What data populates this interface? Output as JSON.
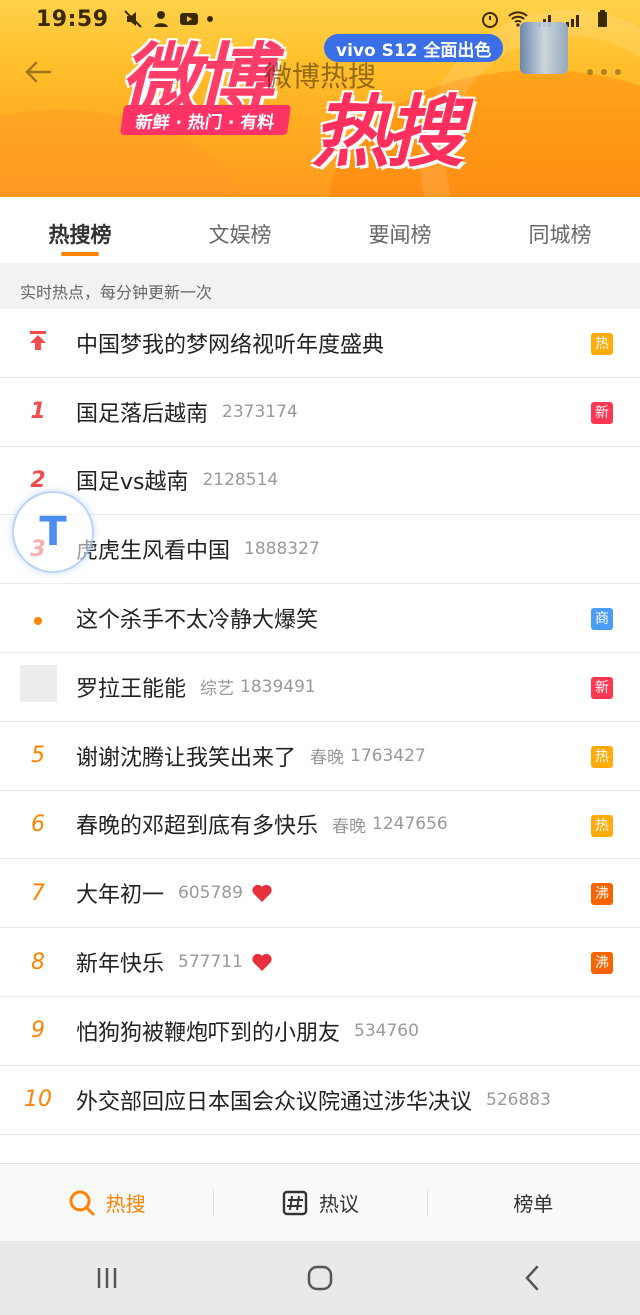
{
  "status_bar": {
    "time": "19:59"
  },
  "header": {
    "title": "微博热搜",
    "logo_text_1": "微博",
    "logo_text_2": "热搜",
    "slogan": "新鲜 · 热门 · 有料",
    "ad_text": "vivo S12 全面出色"
  },
  "tabs": [
    {
      "label": "热搜榜",
      "active": true
    },
    {
      "label": "文娱榜",
      "active": false
    },
    {
      "label": "要闻榜",
      "active": false
    },
    {
      "label": "同城榜",
      "active": false
    }
  ],
  "subheader": "实时热点，每分钟更新一次",
  "list": [
    {
      "rank": "",
      "marker": "pin-icon",
      "title": "中国梦我的梦网络视听年度盛典",
      "category": "",
      "count": "",
      "badge": "热",
      "badge_color": "#ffab0a"
    },
    {
      "rank": "1",
      "marker": "",
      "title": "国足落后越南",
      "category": "",
      "count": "2373174",
      "badge": "新",
      "badge_color": "#ff3852"
    },
    {
      "rank": "2",
      "marker": "",
      "title": "国足vs越南",
      "category": "",
      "count": "2128514",
      "badge": "",
      "badge_color": ""
    },
    {
      "rank": "3",
      "marker": "",
      "title": "虎虎生风看中国",
      "category": "",
      "count": "1888327",
      "badge": "",
      "badge_color": ""
    },
    {
      "rank": "",
      "marker": "dot-icon",
      "title": "这个杀手不太冷静大爆笑",
      "category": "",
      "count": "",
      "badge": "商",
      "badge_color": "#4a9cf5"
    },
    {
      "rank": "",
      "marker": "thumbnail",
      "title": "罗拉王能能",
      "category": "综艺",
      "count": "1839491",
      "badge": "新",
      "badge_color": "#ff3852"
    },
    {
      "rank": "5",
      "marker": "",
      "title": "谢谢沈腾让我笑出来了",
      "category": "春晚",
      "count": "1763427",
      "badge": "热",
      "badge_color": "#ffab0a"
    },
    {
      "rank": "6",
      "marker": "",
      "title": "春晚的邓超到底有多快乐",
      "category": "春晚",
      "count": "1247656",
      "badge": "热",
      "badge_color": "#ffab0a"
    },
    {
      "rank": "7",
      "marker": "",
      "title": "大年初一",
      "category": "",
      "count": "605789",
      "heart": true,
      "badge": "沸",
      "badge_color": "#f86400"
    },
    {
      "rank": "8",
      "marker": "",
      "title": "新年快乐",
      "category": "",
      "count": "577711",
      "heart": true,
      "badge": "沸",
      "badge_color": "#f86400"
    },
    {
      "rank": "9",
      "marker": "",
      "title": "怕狗狗被鞭炮吓到的小朋友",
      "category": "",
      "count": "534760",
      "badge": "",
      "badge_color": ""
    },
    {
      "rank": "10",
      "marker": "",
      "title": "外交部回应日本国会众议院通过涉华决议",
      "category": "",
      "count": "526883",
      "badge": "",
      "badge_color": ""
    }
  ],
  "floating_button": "T",
  "bottom_nav": [
    {
      "label": "热搜",
      "icon": "search-icon",
      "active": true
    },
    {
      "label": "热议",
      "icon": "hashtag-icon",
      "active": false
    },
    {
      "label": "榜单",
      "icon": "",
      "active": false
    }
  ],
  "colors": {
    "accent": "#ff8200",
    "top_rank": "#f04e4e",
    "hot_badge": "#ffab0a",
    "new_badge": "#ff3852",
    "boil_badge": "#f86400",
    "ad_badge": "#4a9cf5"
  }
}
